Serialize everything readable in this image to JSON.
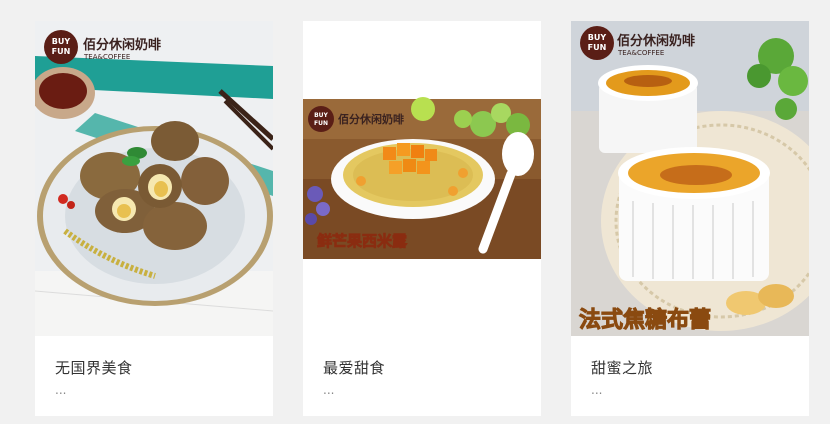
{
  "cards": [
    {
      "title": "无国界美食",
      "more": "...",
      "logo": {
        "badge_top": "BUY",
        "badge_bottom": "FUN",
        "brand": "佰分休闲奶啡",
        "sub": "TEA&COFFEE"
      },
      "photo": "roasted-chicken-rolls-with-quail-eggs"
    },
    {
      "title": "最爱甜食",
      "more": "...",
      "logo": {
        "badge_top": "BUY",
        "badge_bottom": "FUN",
        "brand": "佰分休闲奶啡"
      },
      "caption": "鲜芒果西米露",
      "photo": "mango-sago-dessert"
    },
    {
      "title": "甜蜜之旅",
      "more": "...",
      "logo": {
        "badge_top": "BUY",
        "badge_bottom": "FUN",
        "brand": "佰分休闲奶啡",
        "sub": "TEA&COFFEE"
      },
      "caption": "法式焦糖布蕾",
      "photo": "creme-brulee-ramekins"
    }
  ],
  "colors": {
    "page_bg": "#f1f1f1",
    "card_bg": "#ffffff",
    "badge": "#5a1e16",
    "caption_fill": "#ffe36a"
  }
}
